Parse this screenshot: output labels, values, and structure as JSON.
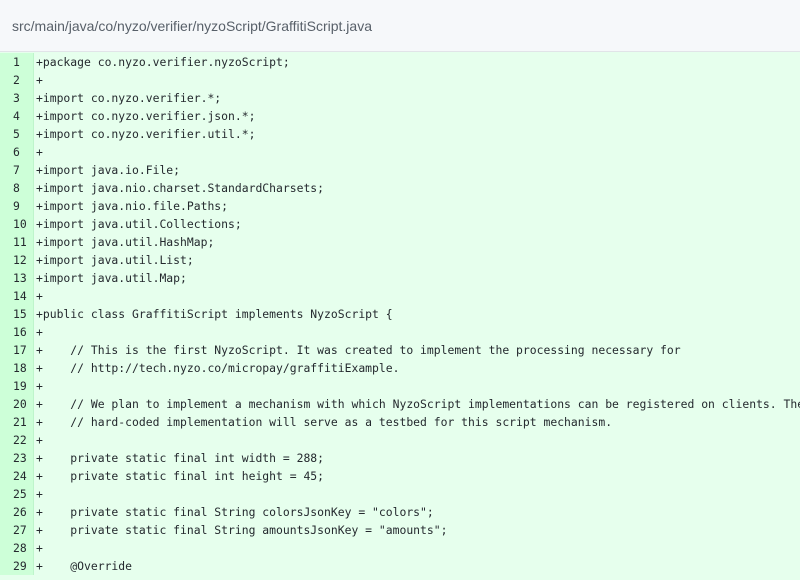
{
  "file": {
    "path": "src/main/java/co/nyzo/verifier/nyzoScript/GraffitiScript.java"
  },
  "colors": {
    "added_line_bg": "#e6ffed",
    "added_num_bg": "#cdffd8",
    "header_bg": "#f6f8fa",
    "text": "#24292e"
  },
  "lines": [
    {
      "num": "1",
      "code": "+package co.nyzo.verifier.nyzoScript;"
    },
    {
      "num": "2",
      "code": "+"
    },
    {
      "num": "3",
      "code": "+import co.nyzo.verifier.*;"
    },
    {
      "num": "4",
      "code": "+import co.nyzo.verifier.json.*;"
    },
    {
      "num": "5",
      "code": "+import co.nyzo.verifier.util.*;"
    },
    {
      "num": "6",
      "code": "+"
    },
    {
      "num": "7",
      "code": "+import java.io.File;"
    },
    {
      "num": "8",
      "code": "+import java.nio.charset.StandardCharsets;"
    },
    {
      "num": "9",
      "code": "+import java.nio.file.Paths;"
    },
    {
      "num": "10",
      "code": "+import java.util.Collections;"
    },
    {
      "num": "11",
      "code": "+import java.util.HashMap;"
    },
    {
      "num": "12",
      "code": "+import java.util.List;"
    },
    {
      "num": "13",
      "code": "+import java.util.Map;"
    },
    {
      "num": "14",
      "code": "+"
    },
    {
      "num": "15",
      "code": "+public class GraffitiScript implements NyzoScript {"
    },
    {
      "num": "16",
      "code": "+"
    },
    {
      "num": "17",
      "code": "+    // This is the first NyzoScript. It was created to implement the processing necessary for"
    },
    {
      "num": "18",
      "code": "+    // http://tech.nyzo.co/micropay/graffitiExample."
    },
    {
      "num": "19",
      "code": "+"
    },
    {
      "num": "20",
      "code": "+    // We plan to implement a mechanism with which NyzoScript implementations can be registered on clients. The"
    },
    {
      "num": "21",
      "code": "+    // hard-coded implementation will serve as a testbed for this script mechanism."
    },
    {
      "num": "22",
      "code": "+"
    },
    {
      "num": "23",
      "code": "+    private static final int width = 288;"
    },
    {
      "num": "24",
      "code": "+    private static final int height = 45;"
    },
    {
      "num": "25",
      "code": "+"
    },
    {
      "num": "26",
      "code": "+    private static final String colorsJsonKey = \"colors\";"
    },
    {
      "num": "27",
      "code": "+    private static final String amountsJsonKey = \"amounts\";"
    },
    {
      "num": "28",
      "code": "+"
    },
    {
      "num": "29",
      "code": "+    @Override"
    }
  ]
}
